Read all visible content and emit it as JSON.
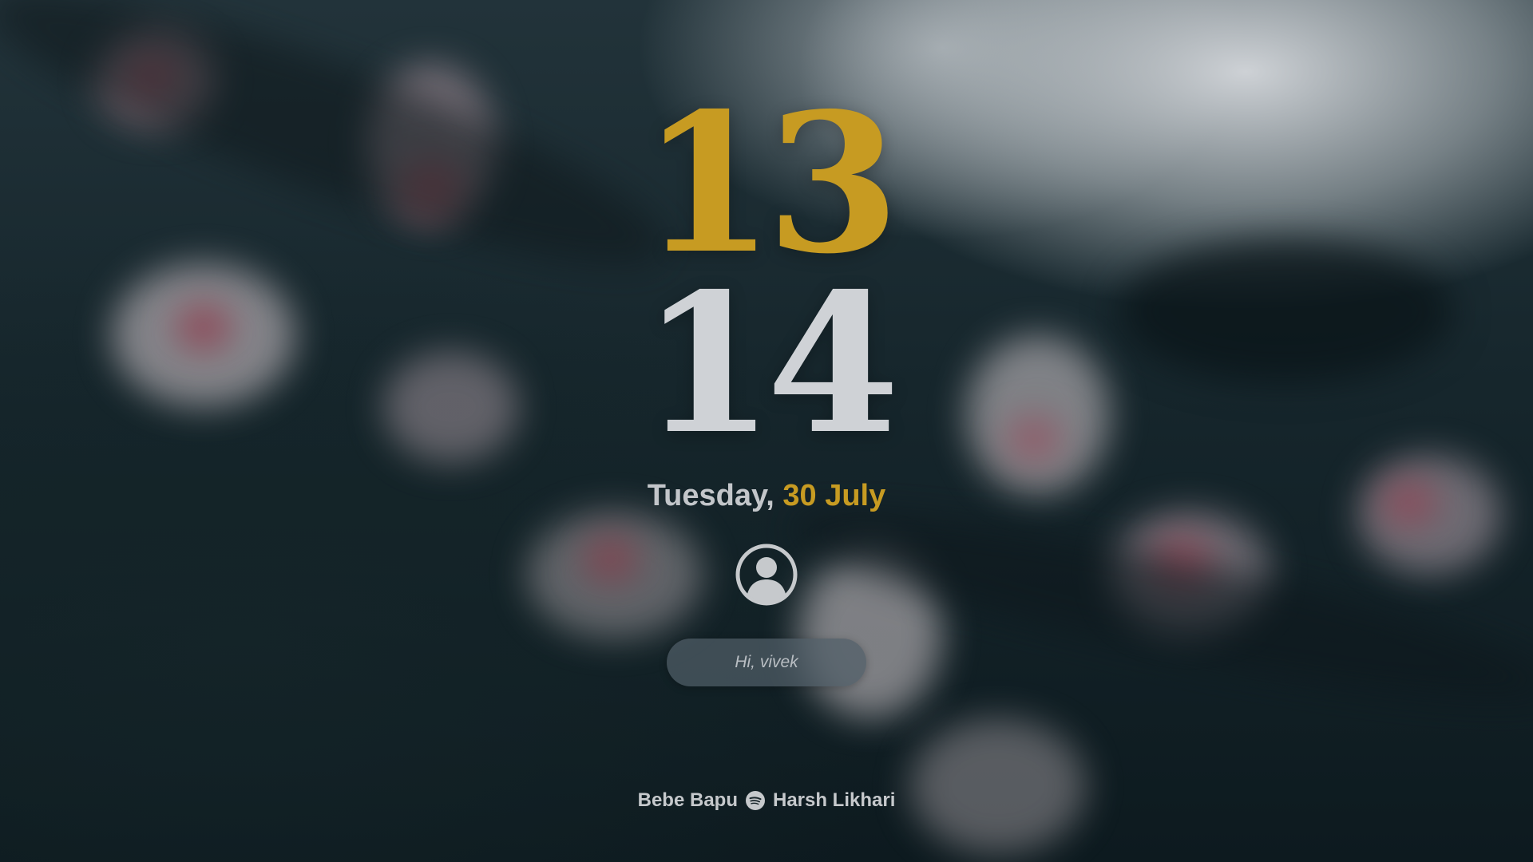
{
  "clock": {
    "hours": "13",
    "minutes": "14"
  },
  "date": {
    "weekday": "Tuesday,",
    "day_month": "30 July"
  },
  "user": {
    "avatar_icon": "user-avatar-icon",
    "greeting": "Hi, vivek"
  },
  "now_playing": {
    "track": "Bebe Bapu",
    "icon": "spotify-icon",
    "artist": "Harsh Likhari"
  },
  "colors": {
    "accent": "#c79b22",
    "text_light": "#cfd2d6",
    "field_background": "#505e68"
  }
}
